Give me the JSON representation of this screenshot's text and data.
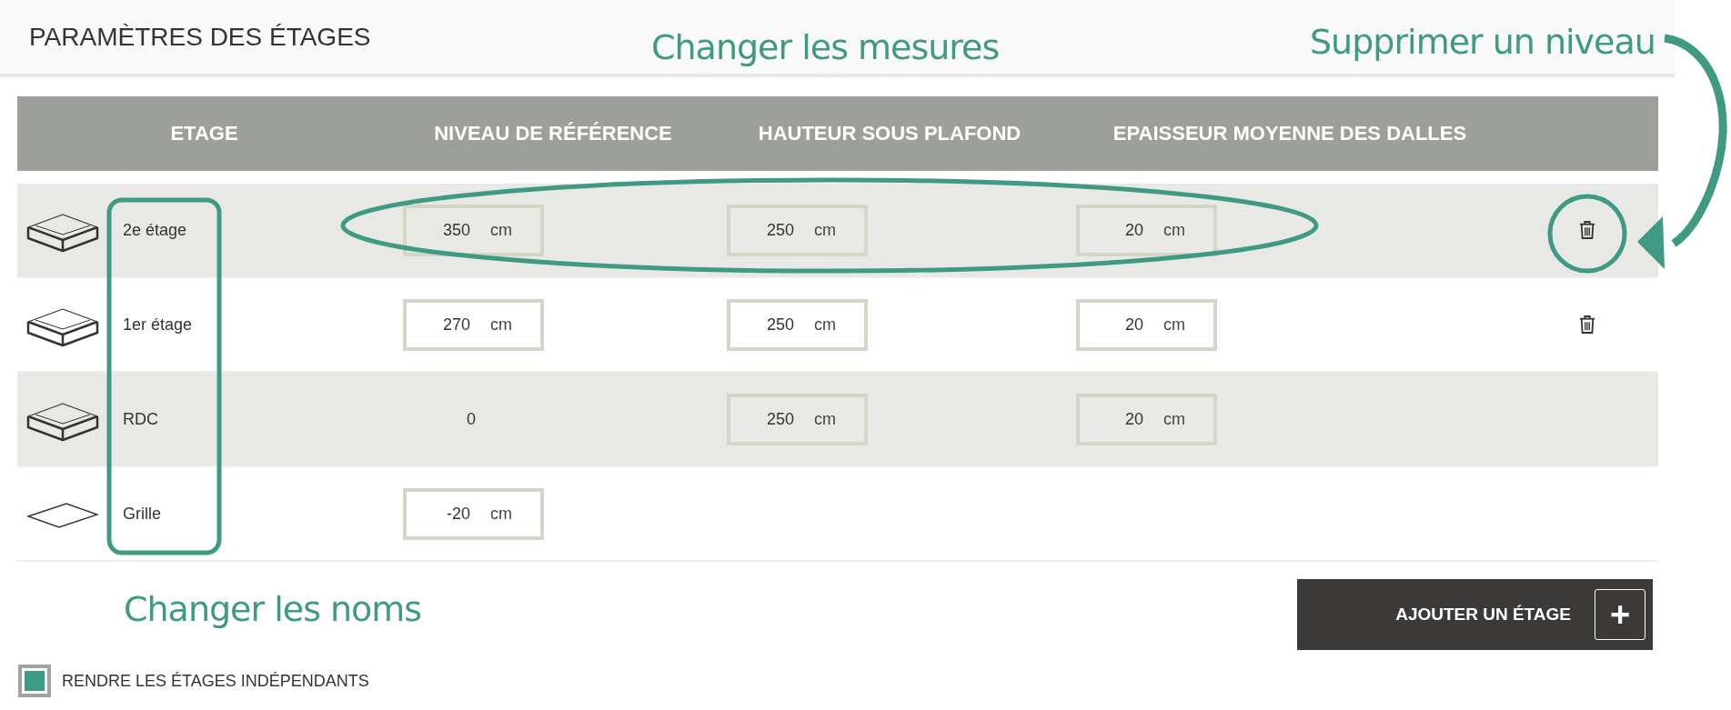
{
  "title": "PARAMÈTRES DES ÉTAGES",
  "columns": [
    "ETAGE",
    "NIVEAU DE RÉFÉRENCE",
    "HAUTEUR SOUS PLAFOND",
    "EPAISSEUR MOYENNE DES DALLES"
  ],
  "rows": [
    {
      "kind": "floor",
      "name": "2e étage",
      "reference": {
        "value": "350",
        "unit": "cm",
        "editable": true
      },
      "height": {
        "value": "250",
        "unit": "cm"
      },
      "thickness": {
        "value": "20",
        "unit": "cm"
      },
      "deletable": true
    },
    {
      "kind": "floor",
      "name": "1er étage",
      "reference": {
        "value": "270",
        "unit": "cm",
        "editable": true
      },
      "height": {
        "value": "250",
        "unit": "cm"
      },
      "thickness": {
        "value": "20",
        "unit": "cm"
      },
      "deletable": true
    },
    {
      "kind": "floor",
      "name": "RDC",
      "reference": {
        "value": "0",
        "editable": false
      },
      "height": {
        "value": "250",
        "unit": "cm"
      },
      "thickness": {
        "value": "20",
        "unit": "cm"
      },
      "deletable": false
    },
    {
      "kind": "grid",
      "name": "Grille",
      "reference": {
        "value": "-20",
        "unit": "cm",
        "editable": true
      },
      "deletable": false
    }
  ],
  "add_button": {
    "label": "AJOUTER UN ÉTAGE",
    "icon": "+"
  },
  "independent": {
    "label": "RENDRE LES ÉTAGES INDÉPENDANTS",
    "checked": true
  },
  "annotations": [
    "Changer les mesures",
    "Supprimer un niveau",
    "Changer les noms"
  ]
}
